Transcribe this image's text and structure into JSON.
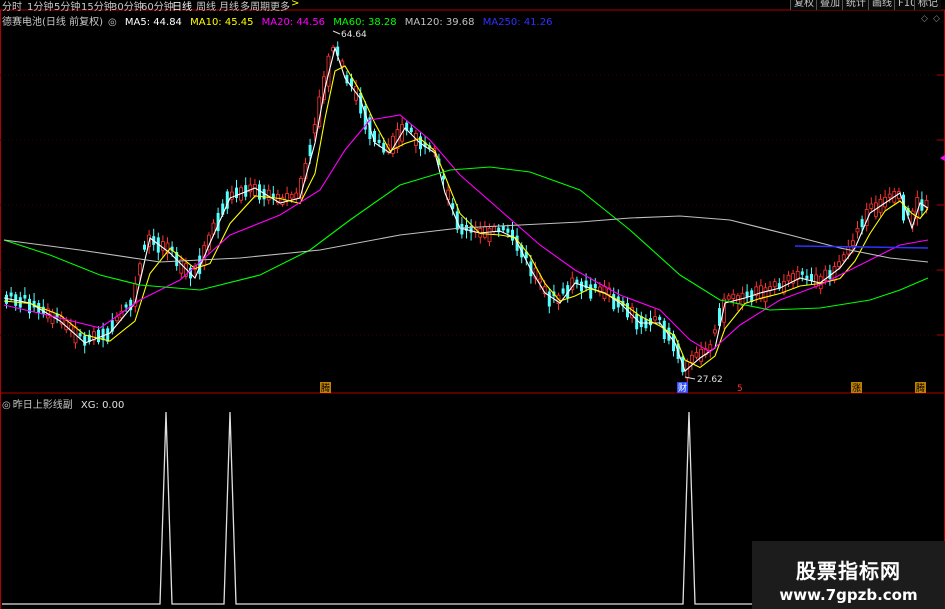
{
  "toolbar": {
    "periods": [
      "分时",
      "1分钟",
      "5分钟",
      "15分钟",
      "30分钟",
      "60分钟",
      "日线",
      "周线",
      "月线",
      "多周期",
      "更多"
    ],
    "active_period": "日线",
    "buttons": [
      "复权",
      "叠加",
      "统计",
      "画线",
      "F10",
      "标记"
    ]
  },
  "main_legend": {
    "stock": "德赛电池(日线 前复权)",
    "ma5": "MA5: 44.84",
    "ma10": "MA10: 45.45",
    "ma20": "MA20: 44.56",
    "ma60": "MA60: 38.28",
    "ma120": "MA120: 39.68",
    "ma250": "MA250: 41.26"
  },
  "annotations": {
    "high": "64.64",
    "low": "27.62"
  },
  "markers": [
    "腾",
    "财",
    "5",
    "涨",
    "腾"
  ],
  "sub_legend": {
    "name": "昨日上影线副",
    "xg": "XG: 0.00"
  },
  "colors": {
    "up": "#ff3232",
    "down": "#54ffff",
    "ma5": "#ffffff",
    "ma10": "#ffff00",
    "ma20": "#ff00ff",
    "ma60": "#00ff00",
    "ma120": "#c0c0c0",
    "ma250": "#3030ff",
    "indicator": "#e0e0e0",
    "frame": "#b00000"
  },
  "watermark": {
    "line1": "股票指标网",
    "line2": "www.7gpzb.com"
  }
}
